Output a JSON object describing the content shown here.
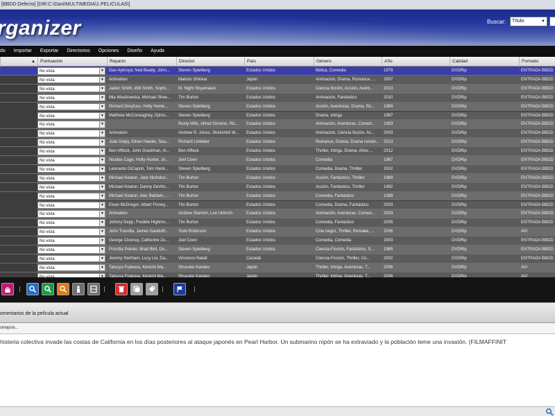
{
  "window": {
    "title": "[BBDD:Defecto] [DIR:C:\\Dani\\MULTIMEDIA\\1.PELICULAS\\]"
  },
  "header": {
    "logo_text": "rganizer",
    "search_label": "Buscar:",
    "search_field_value": "Título"
  },
  "menu": {
    "items": [
      "do",
      "Importar",
      "Exportar",
      "Directorios",
      "Opciones",
      "Diseño",
      "Ayuda"
    ]
  },
  "table": {
    "columns": [
      "Puntuación",
      "Reparto",
      "Director",
      "País",
      "Género",
      "Año",
      "Calidad",
      "Formato"
    ],
    "rows": [
      {
        "rating": "No vista",
        "cast": "Dan Aykroyd, Ned Beatty, John...",
        "director": "Steven Spielberg",
        "country": "Estados Unidos",
        "genre": "Bélica, Comedia",
        "year": "1979",
        "quality": "DVDRip",
        "format": "ENTRADA BBDD"
      },
      {
        "rating": "No vista",
        "cast": "Animation",
        "director": "Makoto Shinkai",
        "country": "Japón",
        "genre": "Animación, Drama, Romance, ...",
        "year": "2007",
        "quality": "DVDRip",
        "format": "ENTRADA BBDD"
      },
      {
        "rating": "No vista",
        "cast": "Jaden Smith, Will Smith, Sophi...",
        "director": "M. Night Shyamalan",
        "country": "Estados Unidos",
        "genre": "Ciencia ficción, Acción, Avent...",
        "year": "2013",
        "quality": "DVDRip",
        "format": "ENTRADA BBDD"
      },
      {
        "rating": "No vista",
        "cast": "Mia Wasikowska, Michael Shee...",
        "director": "Tim Burton",
        "country": "Estados Unidos",
        "genre": "Animación, Fantástico",
        "year": "2010",
        "quality": "DVDRip",
        "format": "ENTRADA BBDD"
      },
      {
        "rating": "No vista",
        "cast": "Richard Dreyfuss, Holly Hunte...",
        "director": "Steven Spielberg",
        "country": "Estados Unidos",
        "genre": "Acción, Aventuras, Drama, Ro...",
        "year": "1989",
        "quality": "DVDRip",
        "format": "ENTRADA BBDD"
      },
      {
        "rating": "No vista",
        "cast": "Matthew McConaughey, Djimo...",
        "director": "Steven Spielberg",
        "country": "Estados Unidos",
        "genre": "Drama, Intriga",
        "year": "1997",
        "quality": "DVDRip",
        "format": "ENTRADA BBDD"
      },
      {
        "rating": "No vista",
        "cast": "",
        "director": "Rusty Mills, Alfred Gimeno, Ric...",
        "country": "Estados Unidos",
        "genre": "Animación, Aventuras, Comed...",
        "year": "1993",
        "quality": "DVDRip",
        "format": "ENTRADA BBDD"
      },
      {
        "rating": "No vista",
        "cast": "Animation",
        "director": "Andrew R. Jones, Shinichirô W...",
        "country": "Estados Unidos",
        "genre": "Animación, Ciencia ficción, Ac...",
        "year": "2003",
        "quality": "DVDRip",
        "format": "ENTRADA BBDD"
      },
      {
        "rating": "No vista",
        "cast": "Julie Delpy, Ethan Hawke, Sea...",
        "director": "Richard Linklater",
        "country": "Estados Unidos",
        "genre": "Romance, Drama, Drama román...",
        "year": "2013",
        "quality": "DVDRip",
        "format": "ENTRADA BBDD"
      },
      {
        "rating": "No vista",
        "cast": "Ben Affleck, John Goodman, Al...",
        "director": "Ben Affleck",
        "country": "Estados Unidos",
        "genre": "Thriller, Intriga, Drama, Años ...",
        "year": "2012",
        "quality": "DVDRip",
        "format": "ENTRADA BBDD"
      },
      {
        "rating": "No vista",
        "cast": "Nicolas Cage, Holly Hunter, Jo...",
        "director": "Joel Coen",
        "country": "Estados Unidos",
        "genre": "Comedia",
        "year": "1987",
        "quality": "DVDRip",
        "format": "ENTRADA BBDD"
      },
      {
        "rating": "No vista",
        "cast": "Leonardo DiCaprio, Tom Hank...",
        "director": "Steven Spielberg",
        "country": "Estados Unidos",
        "genre": "Comedia, Drama, Thriller",
        "year": "2002",
        "quality": "DVDRip",
        "format": "ENTRADA BBDD"
      },
      {
        "rating": "No vista",
        "cast": "Michael Keaton, Jack Nicholso...",
        "director": "Tim Burton",
        "country": "Estados Unidos",
        "genre": "Acción, Fantástico, Thriller",
        "year": "1989",
        "quality": "DVDRip",
        "format": "ENTRADA BBDD"
      },
      {
        "rating": "No vista",
        "cast": "Michael Keaton, Danny DeVito...",
        "director": "Tim Burton",
        "country": "Estados Unidos",
        "genre": "Acción, Fantástico, Thriller",
        "year": "1992",
        "quality": "DVDRip",
        "format": "ENTRADA BBDD"
      },
      {
        "rating": "No vista",
        "cast": "Michael Keaton, Alec Baldwin, ...",
        "director": "Tim Burton",
        "country": "Estados Unidos",
        "genre": "Comedia, Fantástico",
        "year": "1988",
        "quality": "DVDRip",
        "format": "ENTRADA BBDD"
      },
      {
        "rating": "No vista",
        "cast": "Ewan McGregor, Albert Finney...",
        "director": "Tim Burton",
        "country": "Estados Unidos",
        "genre": "Comedia, Drama, Fantástico",
        "year": "2003",
        "quality": "DVDRip",
        "format": "ENTRADA BBDD"
      },
      {
        "rating": "No vista",
        "cast": "Animation",
        "director": "Andrew Stanton, Lee Unkrich",
        "country": "Estados Unidos",
        "genre": "Animación, Aventuras, Comed...",
        "year": "2003",
        "quality": "DVDRip",
        "format": "ENTRADA BBDD"
      },
      {
        "rating": "No vista",
        "cast": "Johnny Depp, Freddie Highmo...",
        "director": "Tim Burton",
        "country": "Estados Unidos",
        "genre": "Comedia, Fantástico",
        "year": "2005",
        "quality": "DVDRip",
        "format": "ENTRADA BBDD"
      },
      {
        "rating": "No vista",
        "cast": "John Travolta, James Gandolfi...",
        "director": "Todd Robinson",
        "country": "Estados Unidos",
        "genre": "Cine negro, Thriller, Remake, ...",
        "year": "2006",
        "quality": "DVDRip",
        "format": "AVI"
      },
      {
        "rating": "No vista",
        "cast": "George Clooney, Catherine Ze...",
        "director": "Joel Coen",
        "country": "Estados Unidos",
        "genre": "Comedia, Comedia",
        "year": "2003",
        "quality": "DVDRip",
        "format": "ENTRADA BBDD"
      },
      {
        "rating": "No vista",
        "cast": "Priscilla Pointer, Brad Bird, Do...",
        "director": "Steven Spielberg",
        "country": "Estados Unidos",
        "genre": "Ciencia-Ficción, Fantástico, S...",
        "year": "1985",
        "quality": "DVDRip",
        "format": "ENTRADA BBDD"
      },
      {
        "rating": "No vista",
        "cast": "Jeremy Northam, Lucy Liu, Da...",
        "director": "Vincenzo Natali",
        "country": "Canadá",
        "genre": "Ciencia-Ficción, Thriller, Co...",
        "year": "2002",
        "quality": "DVDRip",
        "format": "ENTRADA BBDD"
      },
      {
        "rating": "No vista",
        "cast": "Tatsuya Fujiwara, Kenichi Ma...",
        "director": "Shusuke Kaneko",
        "country": "Japón",
        "genre": "Thriller, Intriga, Aventuras, T...",
        "year": "2006",
        "quality": "DVDRip",
        "format": "AVI"
      },
      {
        "rating": "No vista",
        "cast": "Tatsuya Fujiwara, Kenichi Ma...",
        "director": "Shusuke Kaneko",
        "country": "Japón",
        "genre": "Thriller, Intriga, Aventuras, T...",
        "year": "2006",
        "quality": "DVDRip",
        "format": "AVI"
      }
    ]
  },
  "toolbar": {
    "buttons": [
      {
        "name": "hand-icon",
        "color": "#c2186f"
      },
      {
        "name": "search-icon",
        "color": "#1e6fcf"
      },
      {
        "name": "search-green-icon",
        "color": "#1c9a47"
      },
      {
        "name": "search-orange-icon",
        "color": "#e07b12"
      },
      {
        "name": "person-icon",
        "color": "#6f6f6f"
      },
      {
        "name": "film-icon",
        "color": "#6f6f6f"
      },
      {
        "name": "trash-icon",
        "color": "#d32f2f"
      },
      {
        "name": "copy-icon",
        "color": "#9e9e9e"
      },
      {
        "name": "tag-icon",
        "color": "#9e9e9e"
      },
      {
        "name": "flag-icon",
        "color": "#1f3a9f"
      }
    ]
  },
  "comments": {
    "title": "omentarios de la película actual",
    "synopsis_label": "sinopsis...",
    "synopsis_text": "histeria colectiva invade las costas de California en los días posteriores al ataque japonés en Pearl Harbor. Un submarino nipón se ha extraviado y la población teme una invasión. (FILMAFFINIT"
  },
  "colors": {
    "selected_row": "#3c3ea8",
    "banner_top": "#1a2a8a"
  }
}
